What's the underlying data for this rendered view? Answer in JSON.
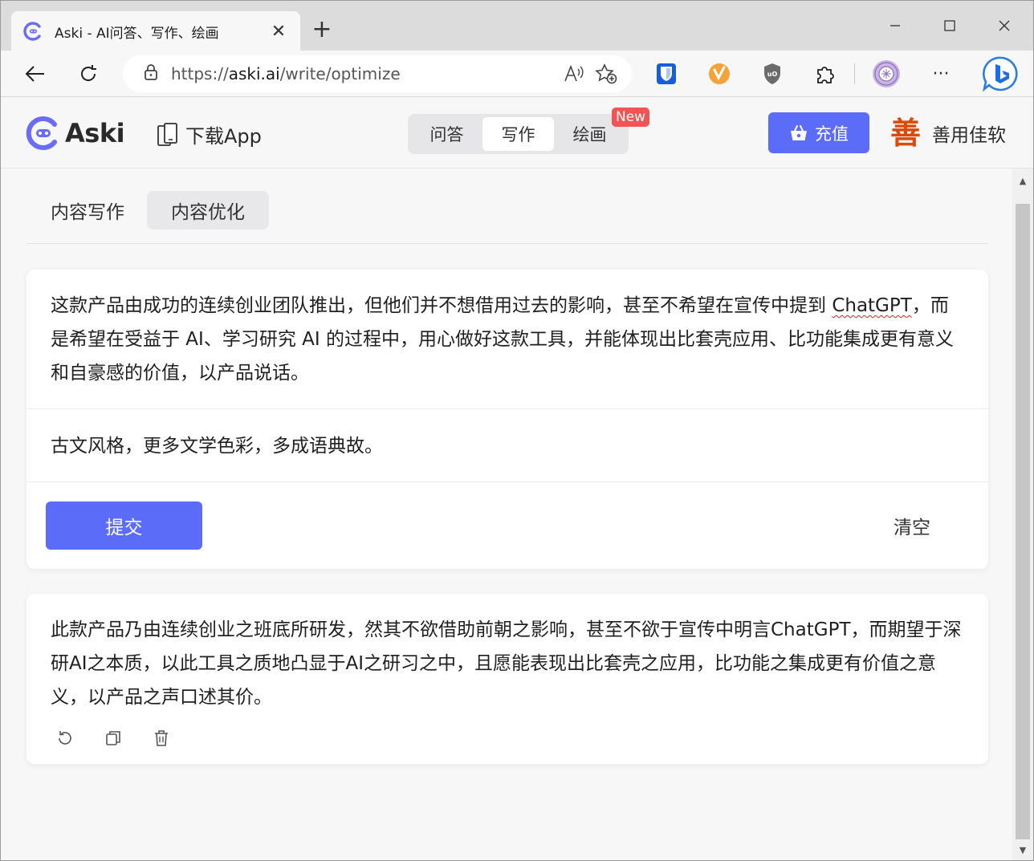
{
  "browser": {
    "tab_title": "Aski - AI问答、写作、绘画",
    "tab_close": "✕",
    "new_tab": "+",
    "url_prefix": "https://",
    "url_domain": "aski.ai",
    "url_path": "/write/optimize",
    "read_aloud": "A̧",
    "more_menu": "···",
    "window_controls": {
      "minimize": "—",
      "maximize": "☐",
      "close": "✕"
    },
    "extensions": [
      "bitwarden-icon",
      "extension-orange-icon",
      "ublock-icon",
      "extensions-puzzle-icon",
      "profile-seal-icon"
    ]
  },
  "header": {
    "logo_text": "Aski",
    "download_label": "下载App",
    "modes": [
      "问答",
      "写作",
      "绘画"
    ],
    "active_mode": "写作",
    "new_badge": "New",
    "recharge_label": "充值",
    "user_avatar": "善",
    "user_name": "善用佳软"
  },
  "subtabs": {
    "items": [
      "内容写作",
      "内容优化"
    ],
    "active": "内容优化"
  },
  "editor": {
    "text_part1": "这款产品由成功的连续创业团队推出，但他们并不想借用过去的影响，甚至不希望在宣传中提到 ",
    "text_spell": "ChatGPT",
    "text_part2": "，而是希望在受益于 AI、学习研究 AI 的过程中，用心做好这款工具，并能体现出比套壳应用、比功能集成更有意义和自豪感的价值，以产品说话。",
    "style_instruction": "古文风格，更多文学色彩，多成语典故。",
    "submit_label": "提交",
    "clear_label": "清空"
  },
  "result": {
    "text": "此款产品乃由连续创业之班底所研发，然其不欲借助前朝之影响，甚至不欲于宣传中明言ChatGPT，而期望于深研AI之本质，以此工具之质地凸显于AI之研习之中，且愿能表现出比套壳之应用，比功能之集成更有价值之意义，以产品之声口述其价。",
    "actions": [
      "regenerate-icon",
      "copy-icon",
      "delete-icon"
    ]
  },
  "colors": {
    "accent": "#5b6cf9",
    "badge": "#f05454",
    "avatar": "#d94a0c"
  }
}
